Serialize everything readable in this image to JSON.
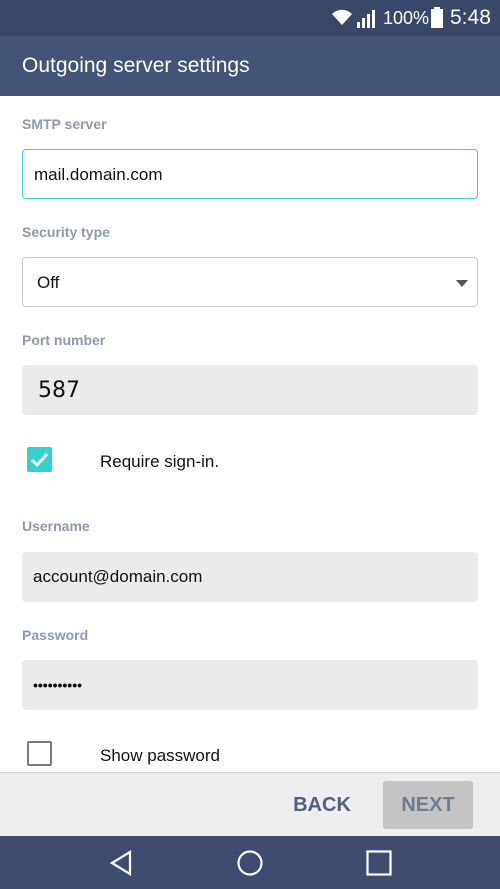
{
  "status_bar": {
    "battery_percent": "100%",
    "time": "5:48",
    "icons": [
      "wifi-icon",
      "signal-icon",
      "battery-icon"
    ]
  },
  "header": {
    "title": "Outgoing server settings"
  },
  "form": {
    "smtp_label": "SMTP server",
    "smtp_value": "mail.domain.com",
    "security_label": "Security type",
    "security_value": "Off",
    "port_label": "Port number",
    "port_value": "587",
    "require_signin_label": "Require sign-in.",
    "require_signin_checked": true,
    "username_label": "Username",
    "username_value": "account@domain.com",
    "password_label": "Password",
    "password_value": "••••••••••",
    "show_password_label": "Show password",
    "show_password_checked": false
  },
  "actions": {
    "back_label": "BACK",
    "next_label": "NEXT"
  },
  "nav": {
    "icons": [
      "back-nav-icon",
      "home-nav-icon",
      "recents-nav-icon"
    ]
  },
  "colors": {
    "status_bar": "#3a4768",
    "app_bar": "#445477",
    "accent": "#35d1cf",
    "label": "#8e9aab",
    "nav_bar": "#3f4c6f"
  }
}
